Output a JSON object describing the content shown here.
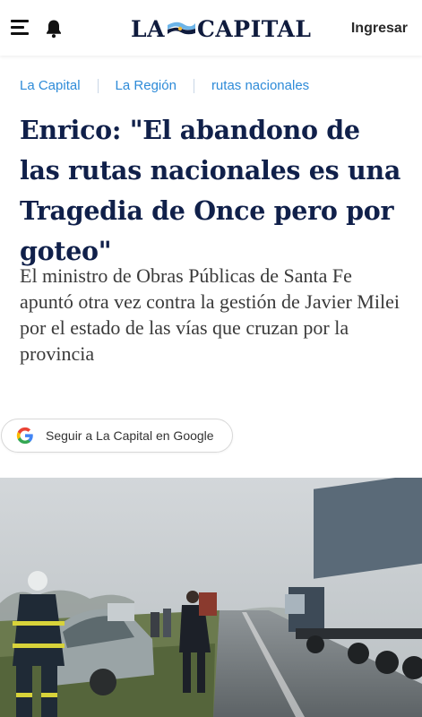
{
  "header": {
    "logo_left": "LA",
    "logo_right": "CAPITAL",
    "login_label": "Ingresar",
    "icons": {
      "menu": "hamburger-menu-icon",
      "notifications": "bell-icon"
    }
  },
  "breadcrumb": [
    "La Capital",
    "La Región",
    "rutas nacionales"
  ],
  "article": {
    "headline": "Enrico: \"El abandono de las rutas nacionales es una Tragedia de Once pero por goteo\"",
    "subtitle": "El ministro de Obras Públicas de Santa Fe apuntó otra vez contra la gestión de Javier Milei por el estado de las vías que cruzan por la provincia"
  },
  "follow_button": {
    "label": "Seguir a La Capital en Google",
    "icon": "google-g-icon"
  },
  "colors": {
    "brand_navy": "#10204a",
    "link_blue": "#2e8bd8",
    "flag_blue": "#6cb4e8"
  }
}
